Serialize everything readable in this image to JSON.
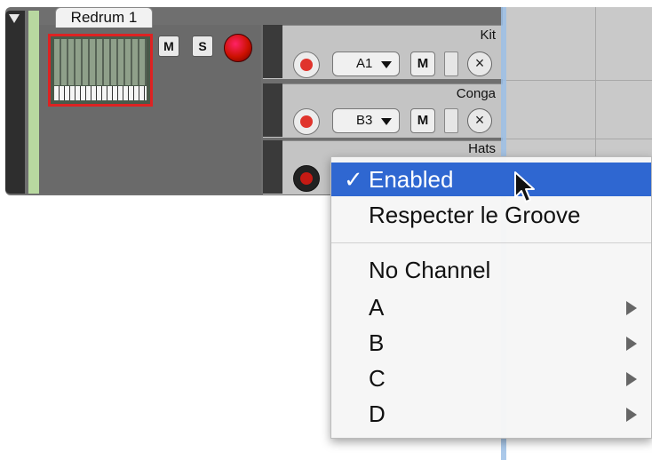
{
  "device": {
    "tab_title": "Redrum 1",
    "mute_label": "M",
    "solo_label": "S"
  },
  "lanes": [
    {
      "name": "Kit",
      "channel": "A1",
      "mute": "M"
    },
    {
      "name": "Conga",
      "channel": "B3",
      "mute": "M"
    },
    {
      "name": "Hats"
    }
  ],
  "menu": {
    "check_mark": "✓",
    "items": [
      {
        "label": "Enabled",
        "checked": true,
        "highlighted": true
      },
      {
        "label": "Respecter le Groove"
      },
      {
        "label": "No Channel"
      },
      {
        "label": "A",
        "submenu": true
      },
      {
        "label": "B",
        "submenu": true
      },
      {
        "label": "C",
        "submenu": true
      },
      {
        "label": "D",
        "submenu": true
      }
    ]
  },
  "icons": {
    "collapse": "triangle-down-icon",
    "remove": "close-circle-icon",
    "record": "record-icon",
    "cursor": "arrow-cursor-icon"
  },
  "colors": {
    "highlight": "#2f67d1",
    "record": "#e0342c",
    "track_color": "#b8d8a0"
  }
}
